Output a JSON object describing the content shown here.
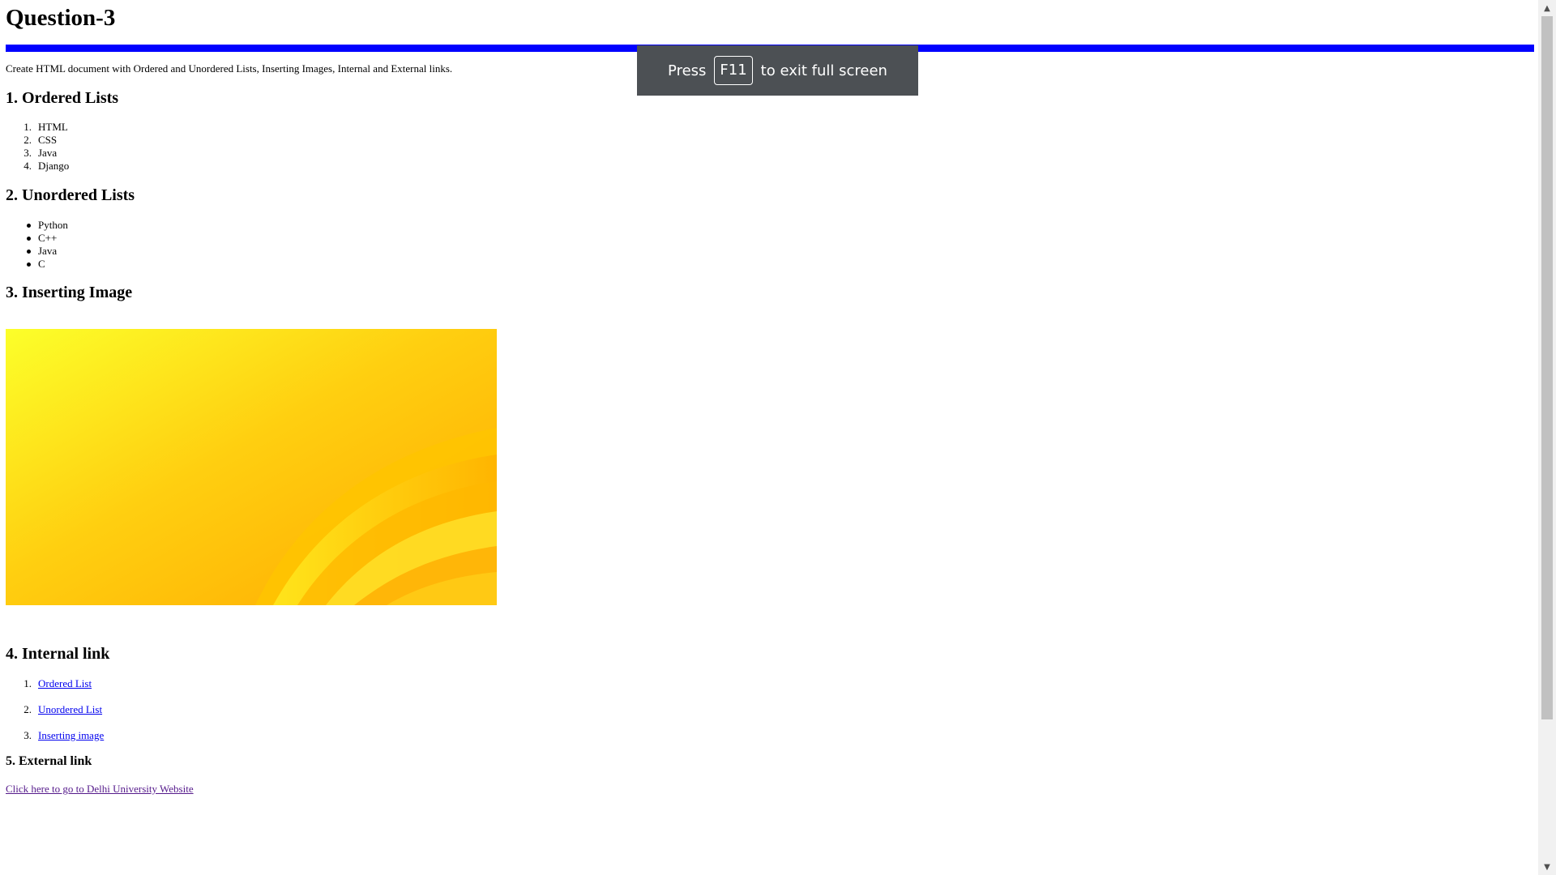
{
  "page": {
    "title": "Question-3",
    "intro": "Create HTML document with Ordered and Unordered Lists, Inserting Images, Internal and External links."
  },
  "ordered_section": {
    "heading": "1. Ordered Lists",
    "items": [
      "HTML",
      "CSS",
      "Java",
      "Django"
    ]
  },
  "unordered_section": {
    "heading": "2. Unordered Lists",
    "items": [
      "Python",
      "C++",
      "Java",
      "C"
    ]
  },
  "image_section": {
    "heading": "3. Inserting Image",
    "image_icon": "yellow-abstract-wallpaper"
  },
  "internal_section": {
    "heading": "4. Internal link",
    "links": [
      "Ordered List",
      "Unordered List",
      "Inserting image"
    ]
  },
  "external_section": {
    "heading": "5. External link",
    "link_text": "Click here to go to Delhi University Website"
  },
  "fullscreen_toast": {
    "prefix": "Press",
    "key": "F11",
    "suffix": "to exit full screen"
  },
  "colors": {
    "divider": "#0000ff",
    "link": "#0000ee",
    "visited_link": "#551a8b",
    "toast_bg": "#4c5054"
  },
  "scrollbar": {
    "up_icon": "scroll-up-arrow-icon",
    "down_icon": "scroll-down-arrow-icon"
  }
}
